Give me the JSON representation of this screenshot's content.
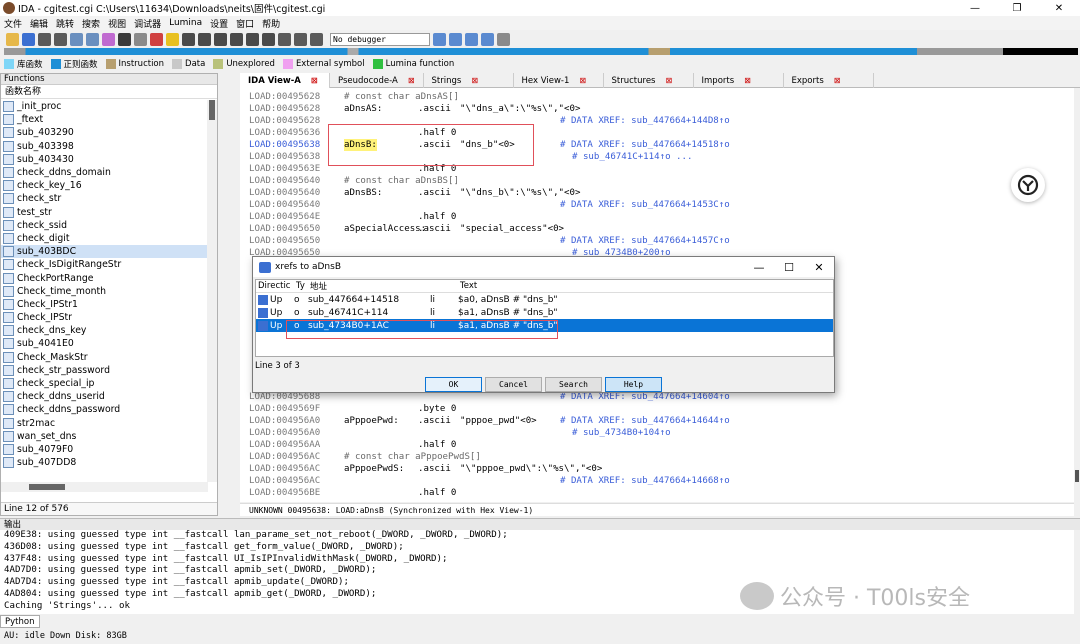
{
  "window": {
    "title": "IDA - cgitest.cgi C:\\Users\\11634\\Downloads\\neits\\固件\\cgitest.cgi",
    "controls": [
      "—",
      "❐",
      "✕"
    ]
  },
  "menu": [
    "文件",
    "编辑",
    "跳转",
    "搜索",
    "视图",
    "调试器",
    "Lumina",
    "设置",
    "窗口",
    "帮助"
  ],
  "toolbar": {
    "debugger": "No debugger"
  },
  "legend": [
    {
      "label": "库函数",
      "color": "#7fd6f7"
    },
    {
      "label": "正则函数",
      "color": "#1f8fd6"
    },
    {
      "label": "Instruction",
      "color": "#b79f6f"
    },
    {
      "label": "Data",
      "color": "#c8c8c8"
    },
    {
      "label": "Unexplored",
      "color": "#b9c27a"
    },
    {
      "label": "External symbol",
      "color": "#f0a0f0"
    },
    {
      "label": "Lumina function",
      "color": "#30c040"
    }
  ],
  "functions": {
    "title": "Functions",
    "column": "函数名称",
    "items": [
      "_init_proc",
      "_ftext",
      "sub_403290",
      "sub_403398",
      "sub_403430",
      "check_ddns_domain",
      "check_key_16",
      "check_str",
      "test_str",
      "check_ssid",
      "check_digit",
      "sub_403BDC",
      "check_IsDigitRangeStr",
      "CheckPortRange",
      "Check_time_month",
      "Check_IPStr1",
      "Check_IPStr",
      "check_dns_key",
      "sub_4041E0",
      "Check_MaskStr",
      "check_str_password",
      "check_special_ip",
      "check_ddns_userid",
      "check_ddns_password",
      "str2mac",
      "wan_set_dns",
      "sub_4079F0",
      "sub_407DD8"
    ],
    "selected_index": 11,
    "status": "Line 12 of 576"
  },
  "tabs": [
    {
      "label": "IDA View-A",
      "active": true
    },
    {
      "label": "Pseudocode-A",
      "active": false
    },
    {
      "label": "Strings",
      "active": false
    },
    {
      "label": "Hex View-1",
      "active": false
    },
    {
      "label": "Structures",
      "active": false
    },
    {
      "label": "Imports",
      "active": false
    },
    {
      "label": "Exports",
      "active": false
    }
  ],
  "disasm": [
    {
      "addr": "LOAD:00495628",
      "lbl": "",
      "mn": "# const char aDnsAS[]",
      "opd": "",
      "cmt": ""
    },
    {
      "addr": "LOAD:00495628",
      "lbl": "aDnsAS:",
      "mn": ".ascii",
      "opd": "\"\\\"dns_a\\\":\\\"%s\\\",\"<0>",
      "cmt": ""
    },
    {
      "addr": "LOAD:00495628",
      "lbl": "",
      "mn": "",
      "opd": "",
      "cmt": "# DATA XREF: sub_447664+144D8↑o"
    },
    {
      "addr": "LOAD:00495636",
      "lbl": "",
      "mn": ".half 0",
      "opd": "",
      "cmt": ""
    },
    {
      "addr": "LOAD:00495638",
      "lbl": "aDnsB:",
      "mn": ".ascii",
      "opd": "\"dns_b\"<0>",
      "cmt": "# DATA XREF: sub_447664+14518↑o"
    },
    {
      "addr": "LOAD:00495638",
      "lbl": "",
      "mn": "",
      "opd": "",
      "cmt": "# sub_46741C+114↑o ..."
    },
    {
      "addr": "LOAD:0049563E",
      "lbl": "",
      "mn": ".half 0",
      "opd": "",
      "cmt": ""
    },
    {
      "addr": "LOAD:00495640",
      "lbl": "",
      "mn": "# const char aDnsBS[]",
      "opd": "",
      "cmt": ""
    },
    {
      "addr": "LOAD:00495640",
      "lbl": "aDnsBS:",
      "mn": ".ascii",
      "opd": "\"\\\"dns_b\\\":\\\"%s\\\",\"<0>",
      "cmt": ""
    },
    {
      "addr": "LOAD:00495640",
      "lbl": "",
      "mn": "",
      "opd": "",
      "cmt": "# DATA XREF: sub_447664+1453C↑o"
    },
    {
      "addr": "LOAD:0049564E",
      "lbl": "",
      "mn": ".half 0",
      "opd": "",
      "cmt": ""
    },
    {
      "addr": "LOAD:00495650",
      "lbl": "aSpecialAccess:",
      "mn": ".ascii",
      "opd": "\"special_access\"<0>",
      "cmt": ""
    },
    {
      "addr": "LOAD:00495650",
      "lbl": "",
      "mn": "",
      "opd": "",
      "cmt": "# DATA XREF: sub_447664+1457C↑o"
    },
    {
      "addr": "LOAD:00495650",
      "lbl": "",
      "mn": "",
      "opd": "",
      "cmt": "# sub_4734B0+200↑o"
    },
    {
      "addr": "LOAD:00495688",
      "lbl": "",
      "mn": "",
      "opd": "",
      "cmt": "# DATA XREF: sub_447664+14604↑o"
    },
    {
      "addr": "LOAD:0049569F",
      "lbl": "",
      "mn": ".byte 0",
      "opd": "",
      "cmt": ""
    },
    {
      "addr": "LOAD:004956A0",
      "lbl": "aPppoePwd:",
      "mn": ".ascii",
      "opd": "\"pppoe_pwd\"<0>",
      "cmt": "# DATA XREF: sub_447664+14644↑o"
    },
    {
      "addr": "LOAD:004956A0",
      "lbl": "",
      "mn": "",
      "opd": "",
      "cmt": "# sub_4734B0+104↑o"
    },
    {
      "addr": "LOAD:004956AA",
      "lbl": "",
      "mn": ".half 0",
      "opd": "",
      "cmt": ""
    },
    {
      "addr": "LOAD:004956AC",
      "lbl": "",
      "mn": "# const char aPppoePwdS[]",
      "opd": "",
      "cmt": ""
    },
    {
      "addr": "LOAD:004956AC",
      "lbl": "aPppoePwdS:",
      "mn": ".ascii",
      "opd": "\"\\\"pppoe_pwd\\\":\\\"%s\\\",\"<0>",
      "cmt": ""
    },
    {
      "addr": "LOAD:004956AC",
      "lbl": "",
      "mn": "",
      "opd": "",
      "cmt": "# DATA XREF: sub_447664+14668↑o"
    },
    {
      "addr": "LOAD:004956BE",
      "lbl": "",
      "mn": ".half 0",
      "opd": "",
      "cmt": ""
    }
  ],
  "disasm_status": "UNKNOWN 00495638: LOAD:aDnsB (Synchronized with Hex View-1)",
  "xrefs": {
    "title": "xrefs to aDnsB",
    "headers": [
      "Directic",
      "Ty",
      "地址",
      "Text"
    ],
    "rows": [
      {
        "dir": "Up",
        "type": "o",
        "addr": "sub_447664+14518",
        "ins": "li",
        "text": "$a0, aDnsB # \"dns_b\""
      },
      {
        "dir": "Up",
        "type": "o",
        "addr": "sub_46741C+114",
        "ins": "li",
        "text": "$a1, aDnsB # \"dns_b\""
      },
      {
        "dir": "Up",
        "type": "o",
        "addr": "sub_4734B0+1AC",
        "ins": "li",
        "text": "$a1, aDnsB # \"dns_b\""
      }
    ],
    "selected_index": 2,
    "status": "Line 3 of 3",
    "buttons": [
      "OK",
      "Cancel",
      "Search",
      "Help"
    ]
  },
  "output": {
    "title": "输出",
    "lines": [
      "409E38: using guessed type int __fastcall lan_parame_set_not_reboot(_DWORD, _DWORD, _DWORD);",
      "436D08: using guessed type int __fastcall get_form_value(_DWORD, _DWORD);",
      "437F48: using guessed type int __fastcall UI_IsIPInvalidWithMask(_DWORD, _DWORD);",
      "4AD7D0: using guessed type int __fastcall apmib_set(_DWORD, _DWORD);",
      "4AD7D4: using guessed type int __fastcall apmib_update(_DWORD);",
      "4AD804: using guessed type int __fastcall apmib_get(_DWORD, _DWORD);",
      "Caching 'Strings'... ok"
    ],
    "tab": "Python"
  },
  "statusbar": "AU:  idle   Down  Disk: 83GB",
  "watermark": "公众号 · T00ls安全"
}
